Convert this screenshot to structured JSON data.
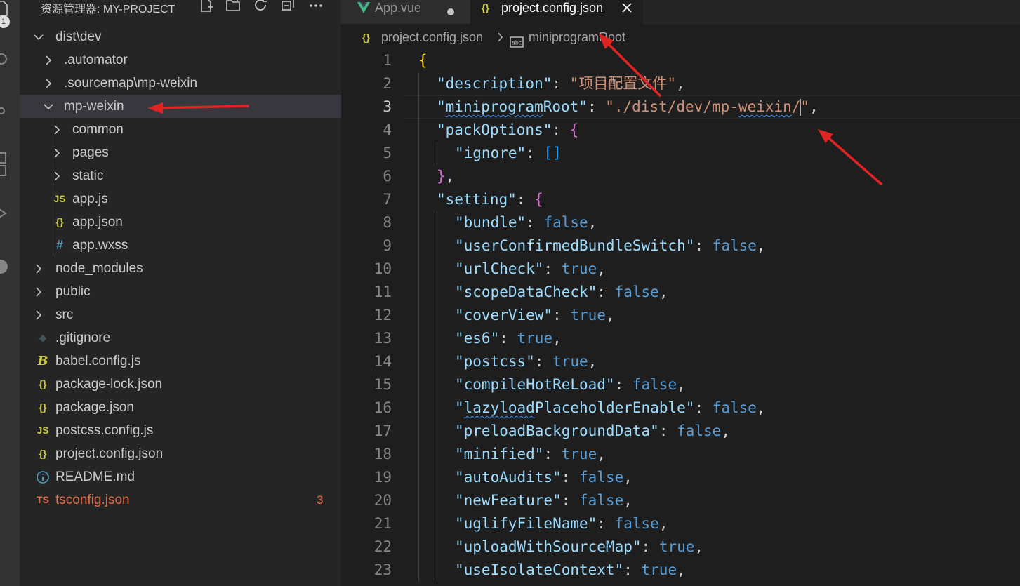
{
  "activity_bar": {
    "badge": "1",
    "icons": [
      "files-icon",
      "search-icon",
      "source-control-icon",
      "extensions-icon",
      "run-icon",
      "account-icon"
    ]
  },
  "sidebar": {
    "title": "资源管理器: MY-PROJECT",
    "actions": [
      "new-file-icon",
      "new-folder-icon",
      "refresh-icon",
      "collapse-all-icon",
      "more-icon"
    ],
    "tree": [
      {
        "label": "dist\\dev",
        "type": "folder",
        "expanded": true,
        "depth": 0
      },
      {
        "label": ".automator",
        "type": "folder",
        "expanded": false,
        "depth": 1
      },
      {
        "label": ".sourcemap\\mp-weixin",
        "type": "folder",
        "expanded": false,
        "depth": 1
      },
      {
        "label": "mp-weixin",
        "type": "folder",
        "expanded": true,
        "depth": 1,
        "selected": true
      },
      {
        "label": "common",
        "type": "folder",
        "expanded": false,
        "depth": 2
      },
      {
        "label": "pages",
        "type": "folder",
        "expanded": false,
        "depth": 2
      },
      {
        "label": "static",
        "type": "folder",
        "expanded": false,
        "depth": 2
      },
      {
        "label": "app.js",
        "type": "file",
        "icon": "js",
        "icon_text": "JS",
        "depth": 2
      },
      {
        "label": "app.json",
        "type": "file",
        "icon": "json",
        "icon_text": "{}",
        "depth": 2
      },
      {
        "label": "app.wxss",
        "type": "file",
        "icon": "css",
        "icon_text": "#",
        "depth": 2
      },
      {
        "label": "node_modules",
        "type": "folder",
        "expanded": false,
        "depth": 0
      },
      {
        "label": "public",
        "type": "folder",
        "expanded": false,
        "depth": 0
      },
      {
        "label": "src",
        "type": "folder",
        "expanded": false,
        "depth": 0
      },
      {
        "label": ".gitignore",
        "type": "file",
        "icon": "git",
        "icon_text": "◆",
        "depth": 0
      },
      {
        "label": "babel.config.js",
        "type": "file",
        "icon": "babel",
        "icon_text": "B",
        "depth": 0
      },
      {
        "label": "package-lock.json",
        "type": "file",
        "icon": "json",
        "icon_text": "{}",
        "depth": 0
      },
      {
        "label": "package.json",
        "type": "file",
        "icon": "json",
        "icon_text": "{}",
        "depth": 0
      },
      {
        "label": "postcss.config.js",
        "type": "file",
        "icon": "js",
        "icon_text": "JS",
        "depth": 0
      },
      {
        "label": "project.config.json",
        "type": "file",
        "icon": "json",
        "icon_text": "{}",
        "depth": 0
      },
      {
        "label": "README.md",
        "type": "file",
        "icon": "info",
        "icon_text": "i",
        "depth": 0
      },
      {
        "label": "tsconfig.json",
        "type": "file",
        "icon": "ts",
        "icon_text": "TS",
        "depth": 0,
        "error": true,
        "badge": "3"
      }
    ]
  },
  "editor": {
    "tabs": [
      {
        "label": "App.vue",
        "icon": "vue-icon",
        "active": false,
        "dirty": true
      },
      {
        "label": "project.config.json",
        "icon": "json-icon",
        "active": true
      }
    ],
    "breadcrumb": {
      "file": "project.config.json",
      "symbol": "miniprogramRoot"
    },
    "current_line": 3,
    "lines": [
      {
        "n": "1",
        "depth": 0,
        "t": [
          {
            "c": "br1",
            "v": "{"
          }
        ]
      },
      {
        "n": "2",
        "depth": 1,
        "t": [
          {
            "c": "k",
            "v": "\"description\""
          },
          {
            "c": "p",
            "v": ": "
          },
          {
            "c": "s",
            "v": "\"项目配置文件\""
          },
          {
            "c": "p",
            "v": ","
          }
        ]
      },
      {
        "n": "3",
        "depth": 1,
        "t": [
          {
            "c": "k",
            "v": "\"miniprogramRoot\""
          },
          {
            "c": "p",
            "v": ": "
          },
          {
            "c": "s",
            "v": "\"./dist/dev/mp-weixin/"
          },
          {
            "c": "caret",
            "v": ""
          },
          {
            "c": "s",
            "v": "\""
          },
          {
            "c": "p",
            "v": ","
          }
        ]
      },
      {
        "n": "4",
        "depth": 1,
        "t": [
          {
            "c": "k",
            "v": "\"packOptions\""
          },
          {
            "c": "p",
            "v": ": "
          },
          {
            "c": "br2",
            "v": "{"
          }
        ]
      },
      {
        "n": "5",
        "depth": 2,
        "t": [
          {
            "c": "k",
            "v": "\"ignore\""
          },
          {
            "c": "p",
            "v": ": "
          },
          {
            "c": "br3",
            "v": "[]"
          }
        ]
      },
      {
        "n": "6",
        "depth": 1,
        "t": [
          {
            "c": "br2",
            "v": "}"
          },
          {
            "c": "p",
            "v": ","
          }
        ]
      },
      {
        "n": "7",
        "depth": 1,
        "t": [
          {
            "c": "k",
            "v": "\"setting\""
          },
          {
            "c": "p",
            "v": ": "
          },
          {
            "c": "br2",
            "v": "{"
          }
        ]
      },
      {
        "n": "8",
        "depth": 2,
        "t": [
          {
            "c": "k",
            "v": "\"bundle\""
          },
          {
            "c": "p",
            "v": ": "
          },
          {
            "c": "b",
            "v": "false"
          },
          {
            "c": "p",
            "v": ","
          }
        ]
      },
      {
        "n": "9",
        "depth": 2,
        "t": [
          {
            "c": "k",
            "v": "\"userConfirmedBundleSwitch\""
          },
          {
            "c": "p",
            "v": ": "
          },
          {
            "c": "b",
            "v": "false"
          },
          {
            "c": "p",
            "v": ","
          }
        ]
      },
      {
        "n": "10",
        "depth": 2,
        "t": [
          {
            "c": "k",
            "v": "\"urlCheck\""
          },
          {
            "c": "p",
            "v": ": "
          },
          {
            "c": "b",
            "v": "true"
          },
          {
            "c": "p",
            "v": ","
          }
        ]
      },
      {
        "n": "11",
        "depth": 2,
        "t": [
          {
            "c": "k",
            "v": "\"scopeDataCheck\""
          },
          {
            "c": "p",
            "v": ": "
          },
          {
            "c": "b",
            "v": "false"
          },
          {
            "c": "p",
            "v": ","
          }
        ]
      },
      {
        "n": "12",
        "depth": 2,
        "t": [
          {
            "c": "k",
            "v": "\"coverView\""
          },
          {
            "c": "p",
            "v": ": "
          },
          {
            "c": "b",
            "v": "true"
          },
          {
            "c": "p",
            "v": ","
          }
        ]
      },
      {
        "n": "13",
        "depth": 2,
        "t": [
          {
            "c": "k",
            "v": "\"es6\""
          },
          {
            "c": "p",
            "v": ": "
          },
          {
            "c": "b",
            "v": "true"
          },
          {
            "c": "p",
            "v": ","
          }
        ]
      },
      {
        "n": "14",
        "depth": 2,
        "t": [
          {
            "c": "k",
            "v": "\"postcss\""
          },
          {
            "c": "p",
            "v": ": "
          },
          {
            "c": "b",
            "v": "true"
          },
          {
            "c": "p",
            "v": ","
          }
        ]
      },
      {
        "n": "15",
        "depth": 2,
        "t": [
          {
            "c": "k",
            "v": "\"compileHotReLoad\""
          },
          {
            "c": "p",
            "v": ": "
          },
          {
            "c": "b",
            "v": "false"
          },
          {
            "c": "p",
            "v": ","
          }
        ]
      },
      {
        "n": "16",
        "depth": 2,
        "t": [
          {
            "c": "k",
            "v": "\"lazyloadPlaceholderEnable\""
          },
          {
            "c": "p",
            "v": ": "
          },
          {
            "c": "b",
            "v": "false"
          },
          {
            "c": "p",
            "v": ","
          }
        ]
      },
      {
        "n": "17",
        "depth": 2,
        "t": [
          {
            "c": "k",
            "v": "\"preloadBackgroundData\""
          },
          {
            "c": "p",
            "v": ": "
          },
          {
            "c": "b",
            "v": "false"
          },
          {
            "c": "p",
            "v": ","
          }
        ]
      },
      {
        "n": "18",
        "depth": 2,
        "t": [
          {
            "c": "k",
            "v": "\"minified\""
          },
          {
            "c": "p",
            "v": ": "
          },
          {
            "c": "b",
            "v": "true"
          },
          {
            "c": "p",
            "v": ","
          }
        ]
      },
      {
        "n": "19",
        "depth": 2,
        "t": [
          {
            "c": "k",
            "v": "\"autoAudits\""
          },
          {
            "c": "p",
            "v": ": "
          },
          {
            "c": "b",
            "v": "false"
          },
          {
            "c": "p",
            "v": ","
          }
        ]
      },
      {
        "n": "20",
        "depth": 2,
        "t": [
          {
            "c": "k",
            "v": "\"newFeature\""
          },
          {
            "c": "p",
            "v": ": "
          },
          {
            "c": "b",
            "v": "false"
          },
          {
            "c": "p",
            "v": ","
          }
        ]
      },
      {
        "n": "21",
        "depth": 2,
        "t": [
          {
            "c": "k",
            "v": "\"uglifyFileName\""
          },
          {
            "c": "p",
            "v": ": "
          },
          {
            "c": "b",
            "v": "false"
          },
          {
            "c": "p",
            "v": ","
          }
        ]
      },
      {
        "n": "22",
        "depth": 2,
        "t": [
          {
            "c": "k",
            "v": "\"uploadWithSourceMap\""
          },
          {
            "c": "p",
            "v": ": "
          },
          {
            "c": "b",
            "v": "true"
          },
          {
            "c": "p",
            "v": ","
          }
        ]
      },
      {
        "n": "23",
        "depth": 2,
        "t": [
          {
            "c": "k",
            "v": "\"useIsolateContext\""
          },
          {
            "c": "p",
            "v": ": "
          },
          {
            "c": "b",
            "v": "true"
          },
          {
            "c": "p",
            "v": ","
          }
        ]
      }
    ]
  },
  "colors": {
    "annotation_arrow": "#e02424",
    "json_icon": "#cbcb41",
    "js_icon": "#cbcb41",
    "css_icon": "#519aba",
    "ts_error": "#e06c4c",
    "selection_row": "#37373d",
    "vue_icon": "#41b883"
  }
}
